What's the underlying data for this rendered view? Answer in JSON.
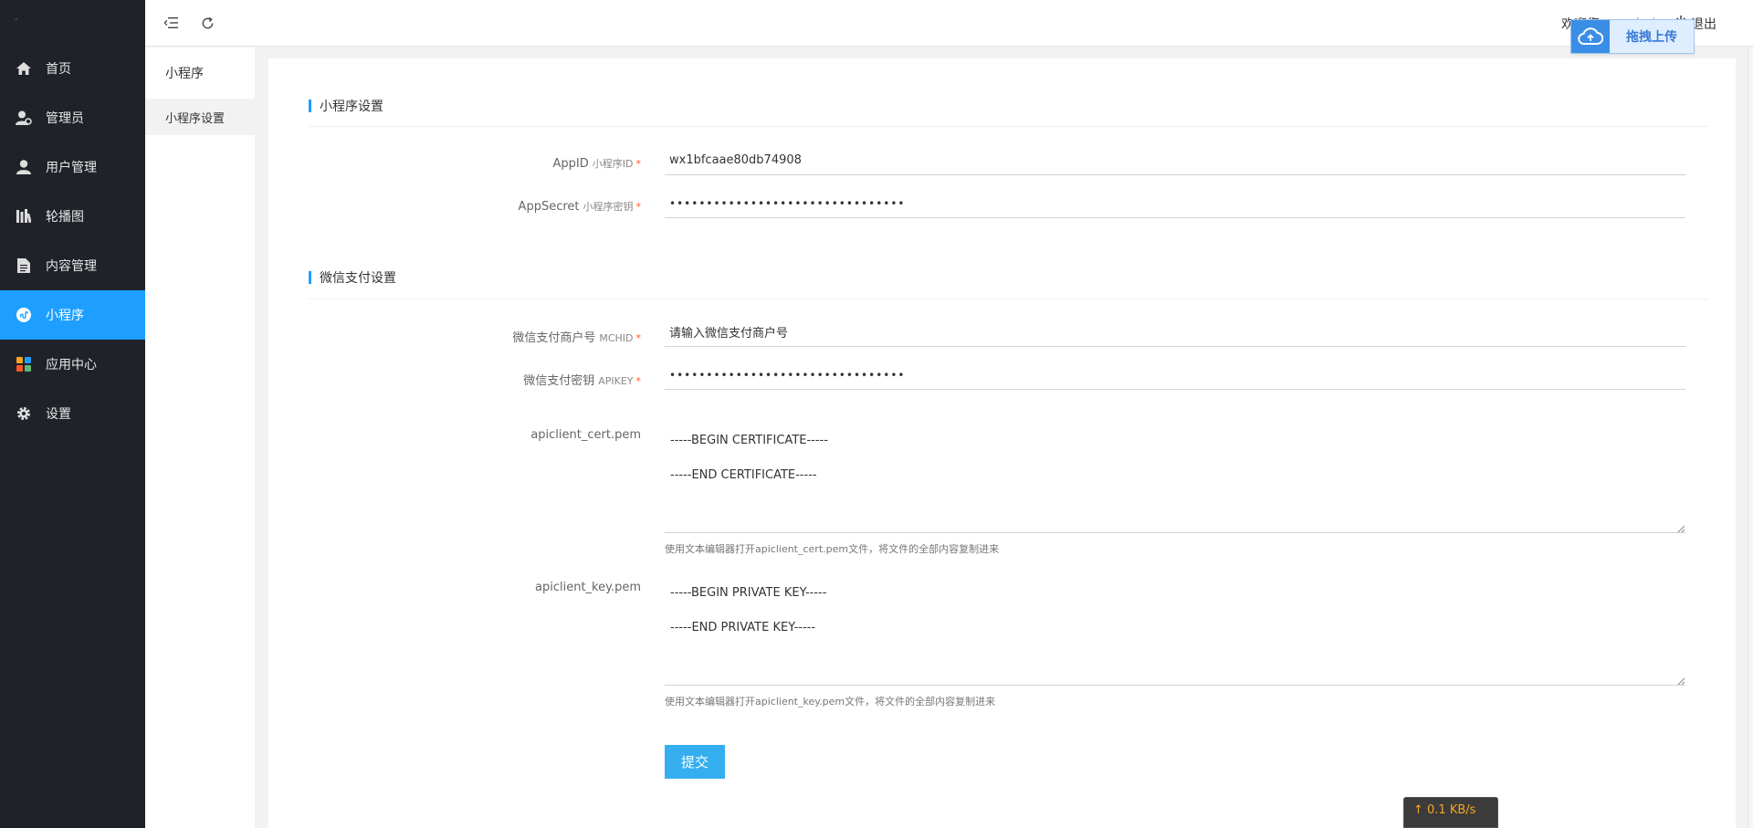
{
  "sidebar": {
    "logo": "-",
    "items": [
      {
        "label": "首页",
        "icon": "home-icon"
      },
      {
        "label": "管理员",
        "icon": "admin-user-icon"
      },
      {
        "label": "用户管理",
        "icon": "user-icon"
      },
      {
        "label": "轮播图",
        "icon": "carousel-icon"
      },
      {
        "label": "内容管理",
        "icon": "document-icon"
      },
      {
        "label": "小程序",
        "icon": "miniprogram-icon",
        "active": true
      },
      {
        "label": "应用中心",
        "icon": "apps-icon"
      },
      {
        "label": "设置",
        "icon": "gear-icon"
      }
    ]
  },
  "header": {
    "welcome": "欢迎您，",
    "username": "admin",
    "logout": "退出"
  },
  "upload_widget": {
    "label": "拖拽上传"
  },
  "subnav": {
    "title": "小程序",
    "items": [
      {
        "label": "小程序设置",
        "active": true
      }
    ]
  },
  "form": {
    "section1_title": "小程序设置",
    "appid": {
      "label": "AppID",
      "sub": "小程序ID",
      "required": "*",
      "value": "wx1bfcaae80db74908"
    },
    "appsecret": {
      "label": "AppSecret",
      "sub": "小程序密钥",
      "required": "*",
      "value": "••••••••••••••••••••••••••••••••"
    },
    "section2_title": "微信支付设置",
    "mchid": {
      "label": "微信支付商户号",
      "sub": "MCHID",
      "required": "*",
      "value": "请输入微信支付商户号"
    },
    "apikey": {
      "label": "微信支付密钥",
      "sub": "APIKEY",
      "required": "*",
      "value": "••••••••••••••••••••••••••••••••"
    },
    "cert": {
      "label": "apiclient_cert.pem",
      "value": "-----BEGIN CERTIFICATE-----\n-----END CERTIFICATE-----",
      "hint": "使用文本编辑器打开apiclient_cert.pem文件，将文件的全部内容复制进来"
    },
    "key": {
      "label": "apiclient_key.pem",
      "value": "-----BEGIN PRIVATE KEY-----\n-----END PRIVATE KEY-----",
      "hint": "使用文本编辑器打开apiclient_key.pem文件，将文件的全部内容复制进来"
    },
    "submit_label": "提交"
  },
  "net_speed": {
    "upload": "↑ 0.1 KB/s"
  },
  "colors": {
    "sidebar_bg": "#20222a",
    "active": "#1e9fff",
    "submit": "#35aef0",
    "required": "#ff5722"
  }
}
